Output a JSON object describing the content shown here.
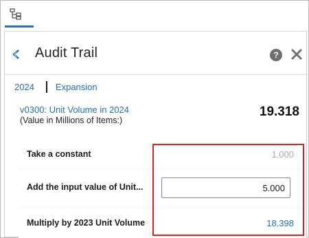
{
  "tabbar": {
    "active_tab_icon": "hierarchy-icon"
  },
  "panel": {
    "title": "Audit Trail",
    "help_icon_glyph": "?",
    "breadcrumb": [
      "2024",
      "Expansion"
    ],
    "metric": {
      "name": "v0300: Unit Volume in 2024",
      "subtitle": "(Value in Millions of Items:)",
      "value": "19.318"
    },
    "steps": [
      {
        "label": "Take a constant",
        "value": "1.000"
      },
      {
        "label": "Add the input value of Unit...",
        "input_value": "5.000"
      },
      {
        "label": "Multiply by 2023 Unit Volume",
        "value": "18.398"
      }
    ]
  },
  "colors": {
    "accent": "#1f72c4",
    "link": "#1f6fb5",
    "highlight": "#e02020",
    "muted_value": "#a9a9a9"
  }
}
